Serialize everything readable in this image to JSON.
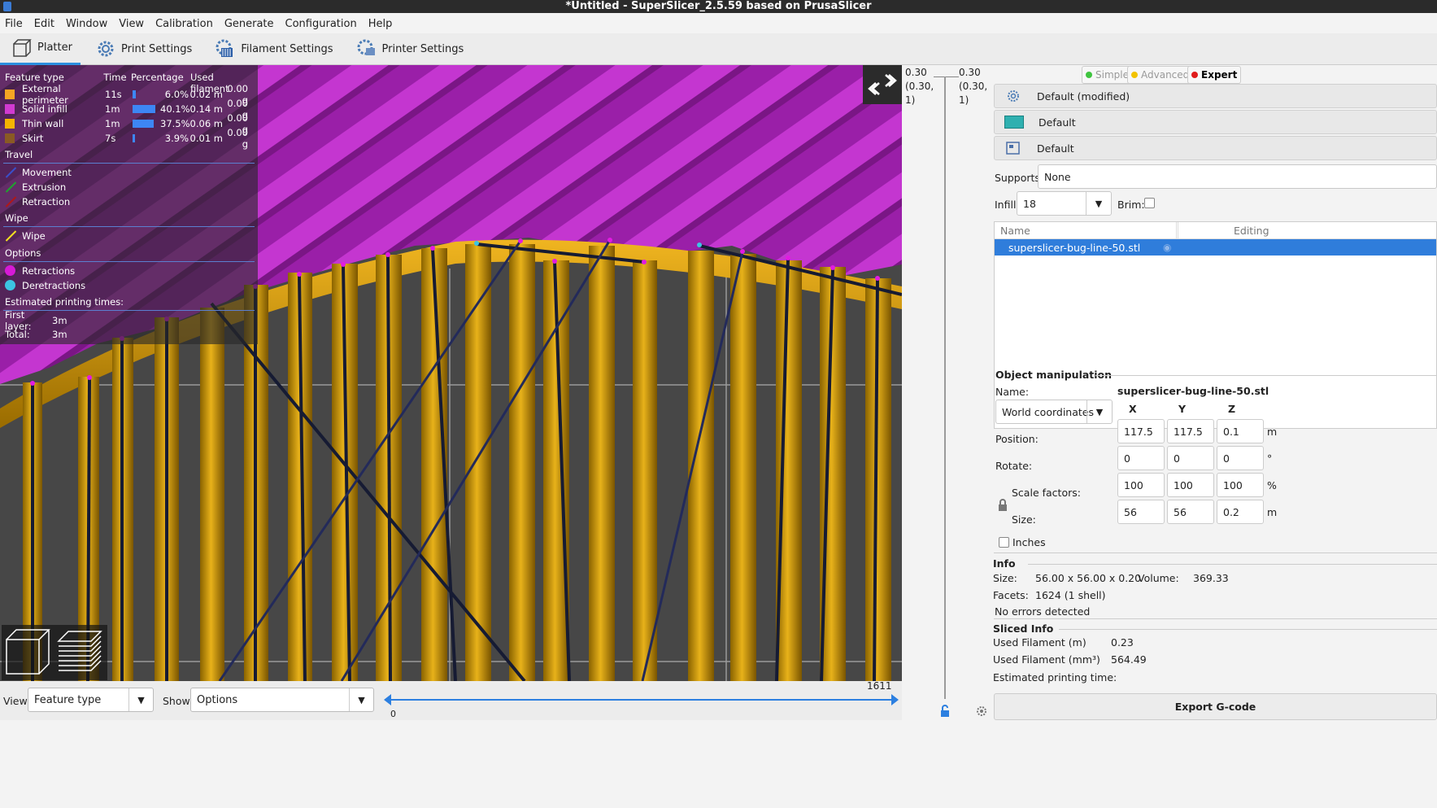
{
  "title": "*Untitled - SuperSlicer_2.5.59  based on PrusaSlicer",
  "menu": [
    "File",
    "Edit",
    "Window",
    "View",
    "Calibration",
    "Generate",
    "Configuration",
    "Help"
  ],
  "tabs": [
    {
      "label": "Platter",
      "icon": "platter-icon"
    },
    {
      "label": "Print Settings",
      "icon": "print-settings-icon"
    },
    {
      "label": "Filament Settings",
      "icon": "filament-settings-icon"
    },
    {
      "label": "Printer Settings",
      "icon": "printer-settings-icon"
    }
  ],
  "legend": {
    "headers": {
      "feature": "Feature type",
      "time": "Time",
      "percentage": "Percentage",
      "used": "Used filament"
    },
    "features": [
      {
        "name": "External perimeter",
        "time": "11s",
        "pct": "6.0%",
        "pct_value": 6.0,
        "len": "0.02 m",
        "weight": "0.00 g",
        "color": "#f5a623"
      },
      {
        "name": "Solid infill",
        "time": "1m",
        "pct": "40.1%",
        "pct_value": 40.1,
        "len": "0.14 m",
        "weight": "0.00 g",
        "color": "#d13ad1"
      },
      {
        "name": "Thin wall",
        "time": "1m",
        "pct": "37.5%",
        "pct_value": 37.5,
        "len": "0.06 m",
        "weight": "0.00 g",
        "color": "#f5b400"
      },
      {
        "name": "Skirt",
        "time": "7s",
        "pct": "3.9%",
        "pct_value": 3.9,
        "len": "0.01 m",
        "weight": "0.00 g",
        "color": "#8a5a24"
      }
    ],
    "travel_title": "Travel",
    "travel": [
      {
        "name": "Movement",
        "color": "#3a4fc9"
      },
      {
        "name": "Extrusion",
        "color": "#1fa32e"
      },
      {
        "name": "Retraction",
        "color": "#b01818"
      }
    ],
    "wipe_title": "Wipe",
    "wipe": {
      "name": "Wipe",
      "color": "#f5e021"
    },
    "options_title": "Options",
    "options": [
      {
        "name": "Retractions",
        "color": "#d61ad6"
      },
      {
        "name": "Deretractions",
        "color": "#3cc4e3"
      }
    ],
    "est_title": "Estimated printing times:",
    "first_layer_label": "First layer:",
    "first_layer": "3m",
    "total_label": "Total:",
    "total": "3m"
  },
  "bottom": {
    "view_label": "View",
    "view_value": "Feature type",
    "show_label": "Show",
    "show_value": "Options",
    "slider_max": "1611",
    "slider_min": "0"
  },
  "layer_slider": {
    "top_left": "0.30",
    "top_left_sub1": "(0.30,",
    "top_left_sub2": "1)",
    "top_right": "0.30",
    "top_right_sub1": "(0.30,",
    "top_right_sub2": "1)"
  },
  "modes": [
    "Simple",
    "Advanced",
    "Expert"
  ],
  "presets": {
    "print": "Default (modified)",
    "filament": "Default",
    "printer": "Default",
    "filament_color": "#2fb0b0"
  },
  "supports": {
    "label": "Supports:",
    "value": "None"
  },
  "infill": {
    "label": "Infill:",
    "value": "18"
  },
  "brim": {
    "label": "Brim:"
  },
  "objects": {
    "col_name": "Name",
    "col_editing": "Editing",
    "items": [
      "superslicer-bug-line-50.stl"
    ]
  },
  "manip": {
    "title": "Object manipulation",
    "name_label": "Name:",
    "name_value": "superslicer-bug-line-50.stl",
    "coords": "World coordinates",
    "x": "X",
    "y": "Y",
    "z": "Z",
    "position_label": "Position:",
    "position": [
      "117.5",
      "117.5",
      "0.1"
    ],
    "position_unit": "m",
    "rotate_label": "Rotate:",
    "rotate": [
      "0",
      "0",
      "0"
    ],
    "rotate_unit": "°",
    "scale_label": "Scale factors:",
    "scale": [
      "100",
      "100",
      "100"
    ],
    "scale_unit": "%",
    "size_label": "Size:",
    "size": [
      "56",
      "56",
      "0.2"
    ],
    "size_unit": "m",
    "inches_label": "Inches"
  },
  "info": {
    "title": "Info",
    "size_label": "Size:",
    "size": "56.00 x 56.00 x 0.20",
    "volume_label": "Volume:",
    "volume": "369.33",
    "facets_label": "Facets:",
    "facets": "1624 (1 shell)",
    "errors": "No errors detected"
  },
  "sliced": {
    "title": "Sliced Info",
    "used_m_label": "Used Filament (m)",
    "used_m": "0.23",
    "used_mm3_label": "Used Filament (mm³)",
    "used_mm3": "564.49",
    "est_label": "Estimated printing time:"
  },
  "export_label": "Export G-code"
}
